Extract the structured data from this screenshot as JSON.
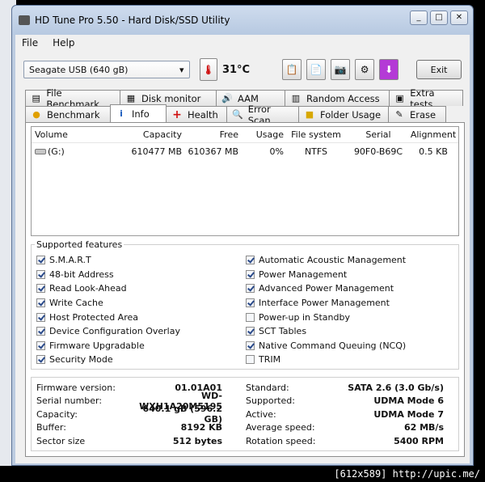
{
  "window": {
    "title": "HD Tune Pro 5.50 - Hard Disk/SSD Utility",
    "minimize": "_",
    "maximize": "□",
    "close": "✕"
  },
  "menu": {
    "file": "File",
    "help": "Help"
  },
  "toolbar": {
    "drive": "Seagate USB (640 gB)",
    "temperature": "31°C",
    "exit_label": "Exit"
  },
  "tabs_row1": [
    {
      "label": "File Benchmark",
      "icon": "file-benchmark-icon"
    },
    {
      "label": "Disk monitor",
      "icon": "disk-monitor-icon"
    },
    {
      "label": "AAM",
      "icon": "speaker-icon"
    },
    {
      "label": "Random Access",
      "icon": "random-access-icon"
    },
    {
      "label": "Extra tests",
      "icon": "extra-tests-icon"
    }
  ],
  "tabs_row2": [
    {
      "label": "Benchmark",
      "icon": "benchmark-icon"
    },
    {
      "label": "Info",
      "icon": "info-icon"
    },
    {
      "label": "Health",
      "icon": "health-icon"
    },
    {
      "label": "Error Scan",
      "icon": "magnifier-icon"
    },
    {
      "label": "Folder Usage",
      "icon": "folder-icon"
    },
    {
      "label": "Erase",
      "icon": "erase-icon"
    }
  ],
  "volumes": {
    "headers": [
      "Volume",
      "Capacity",
      "Free",
      "Usage",
      "File system",
      "Serial",
      "Alignment"
    ],
    "rows": [
      {
        "volume": "(G:)",
        "capacity": "610477 MB",
        "free": "610367 MB",
        "usage": "0%",
        "fs": "NTFS",
        "serial": "90F0-B69C",
        "alignment": "0.5 KB"
      }
    ]
  },
  "features": {
    "title": "Supported features",
    "left": [
      {
        "label": "S.M.A.R.T",
        "checked": true
      },
      {
        "label": "48-bit Address",
        "checked": true
      },
      {
        "label": "Read Look-Ahead",
        "checked": true
      },
      {
        "label": "Write Cache",
        "checked": true
      },
      {
        "label": "Host Protected Area",
        "checked": true
      },
      {
        "label": "Device Configuration Overlay",
        "checked": true
      },
      {
        "label": "Firmware Upgradable",
        "checked": true
      },
      {
        "label": "Security Mode",
        "checked": true
      }
    ],
    "right": [
      {
        "label": "Automatic Acoustic Management",
        "checked": true
      },
      {
        "label": "Power Management",
        "checked": true
      },
      {
        "label": "Advanced Power Management",
        "checked": true
      },
      {
        "label": "Interface Power Management",
        "checked": true
      },
      {
        "label": "Power-up in Standby",
        "checked": false
      },
      {
        "label": "SCT Tables",
        "checked": true
      },
      {
        "label": "Native Command Queuing (NCQ)",
        "checked": true
      },
      {
        "label": "TRIM",
        "checked": false
      }
    ]
  },
  "info": {
    "left": [
      {
        "label": "Firmware version:",
        "value": "01.01A01"
      },
      {
        "label": "Serial number:",
        "value": "WD-WXH1A20M5195"
      },
      {
        "label": "Capacity:",
        "value": "640.1 gB (596.2 GB)"
      },
      {
        "label": "Buffer:",
        "value": "8192 KB"
      },
      {
        "label": "Sector size",
        "value": "512 bytes"
      }
    ],
    "right": [
      {
        "label": "Standard:",
        "value": "SATA 2.6 (3.0 Gb/s)"
      },
      {
        "label": "Supported:",
        "value": "UDMA Mode 6"
      },
      {
        "label": "Active:",
        "value": "UDMA Mode 7"
      },
      {
        "label": "Average speed:",
        "value": "62 MB/s"
      },
      {
        "label": "Rotation speed:",
        "value": "5400 RPM"
      }
    ]
  },
  "watermark": "[612x589] http://upic.me/"
}
